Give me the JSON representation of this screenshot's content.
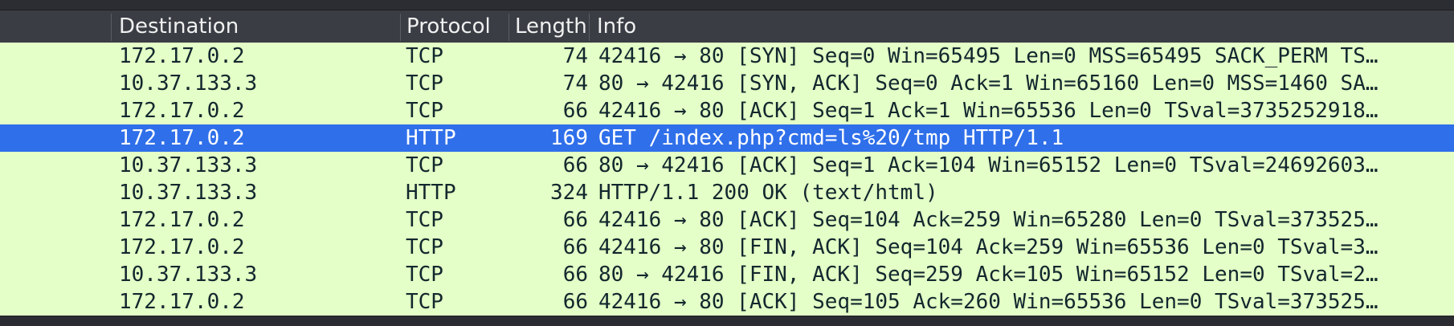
{
  "columns": {
    "destination": "Destination",
    "protocol": "Protocol",
    "length": "Length",
    "info": "Info"
  },
  "packets": [
    {
      "destination": "172.17.0.2",
      "protocol": "TCP",
      "length": "74",
      "info": "42416 → 80 [SYN] Seq=0 Win=65495 Len=0 MSS=65495 SACK_PERM TS…"
    },
    {
      "destination": "10.37.133.3",
      "protocol": "TCP",
      "length": "74",
      "info": "80 → 42416 [SYN, ACK] Seq=0 Ack=1 Win=65160 Len=0 MSS=1460 SA…"
    },
    {
      "destination": "172.17.0.2",
      "protocol": "TCP",
      "length": "66",
      "info": "42416 → 80 [ACK] Seq=1 Ack=1 Win=65536 Len=0 TSval=3735252918…"
    },
    {
      "destination": "172.17.0.2",
      "protocol": "HTTP",
      "length": "169",
      "info": "GET /index.php?cmd=ls%20/tmp HTTP/1.1"
    },
    {
      "destination": "10.37.133.3",
      "protocol": "TCP",
      "length": "66",
      "info": "80 → 42416 [ACK] Seq=1 Ack=104 Win=65152 Len=0 TSval=24692603…"
    },
    {
      "destination": "10.37.133.3",
      "protocol": "HTTP",
      "length": "324",
      "info": "HTTP/1.1 200 OK  (text/html)"
    },
    {
      "destination": "172.17.0.2",
      "protocol": "TCP",
      "length": "66",
      "info": "42416 → 80 [ACK] Seq=104 Ack=259 Win=65280 Len=0 TSval=373525…"
    },
    {
      "destination": "172.17.0.2",
      "protocol": "TCP",
      "length": "66",
      "info": "42416 → 80 [FIN, ACK] Seq=104 Ack=259 Win=65536 Len=0 TSval=3…"
    },
    {
      "destination": "10.37.133.3",
      "protocol": "TCP",
      "length": "66",
      "info": "80 → 42416 [FIN, ACK] Seq=259 Ack=105 Win=65152 Len=0 TSval=2…"
    },
    {
      "destination": "172.17.0.2",
      "protocol": "TCP",
      "length": "66",
      "info": "42416 → 80 [ACK] Seq=105 Ack=260 Win=65536 Len=0 TSval=373525…"
    }
  ],
  "selected_row": "3",
  "colors": {
    "row_bg": "#e4ffc7",
    "row_text": "#12272e",
    "selected_bg": "#2f6fea",
    "selected_text": "#ffffff",
    "header_bg": "#3a3d44",
    "header_text": "#f0f0f0"
  }
}
